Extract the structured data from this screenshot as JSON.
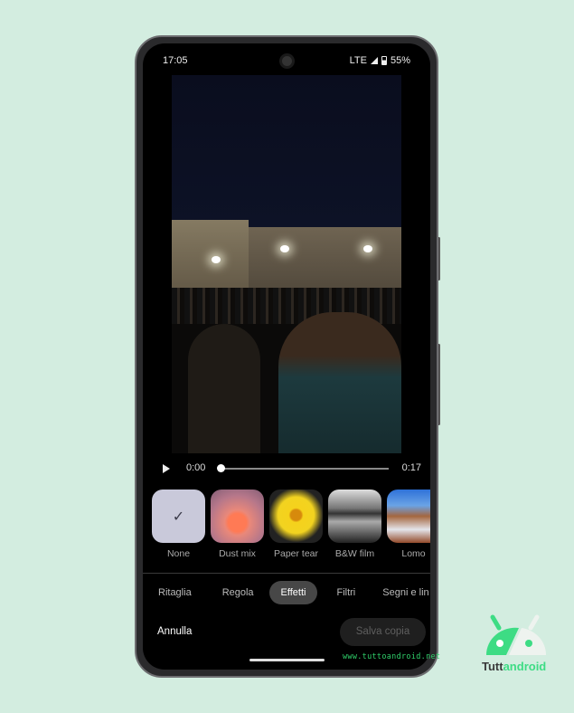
{
  "status": {
    "time": "17:05",
    "network": "LTE",
    "battery": "55%"
  },
  "player": {
    "current_time": "0:00",
    "duration": "0:17",
    "progress": 0
  },
  "effects": [
    {
      "label": "None",
      "selected": true
    },
    {
      "label": "Dust mix"
    },
    {
      "label": "Paper tear"
    },
    {
      "label": "B&W film"
    },
    {
      "label": "Lomo"
    }
  ],
  "tabs": [
    {
      "label": "Ritaglia"
    },
    {
      "label": "Regola"
    },
    {
      "label": "Effetti",
      "active": true
    },
    {
      "label": "Filtri"
    },
    {
      "label": "Segni e lin"
    }
  ],
  "actions": {
    "cancel": "Annulla",
    "save_copy": "Salva copia"
  },
  "watermark": "www.tuttoandroid.net",
  "logo": {
    "text": "Tuttandroid",
    "color": "#3ddc84"
  },
  "colors": {
    "background": "#d3ede0",
    "active_tab": "#474747"
  }
}
